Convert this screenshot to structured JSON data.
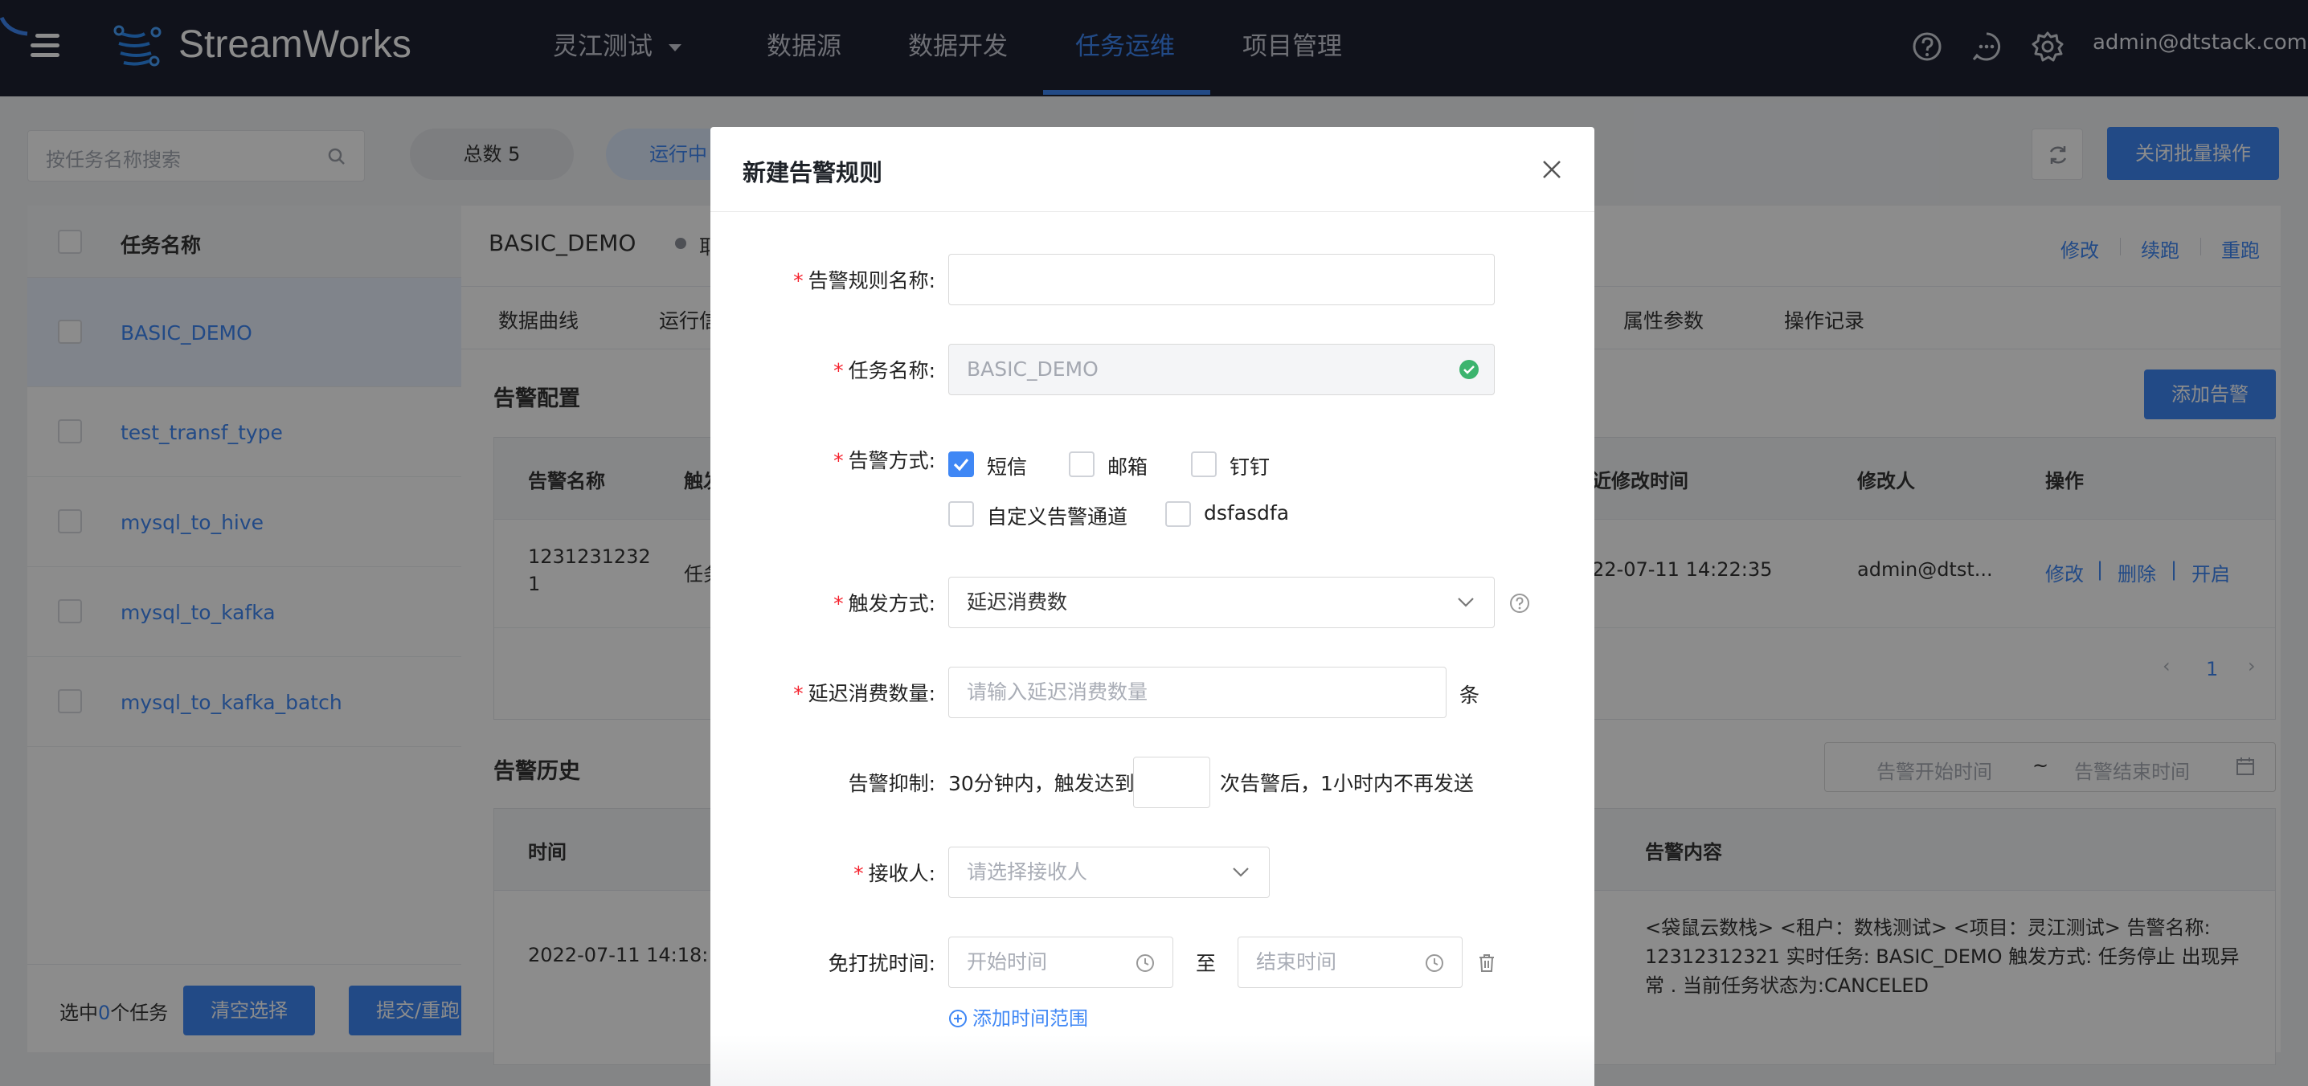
{
  "topbar": {
    "brand": "StreamWorks",
    "project": "灵江测试",
    "nav": [
      "数据源",
      "数据开发",
      "任务运维",
      "项目管理"
    ],
    "active_nav": "任务运维",
    "user": "admin@dtstack.com",
    "icons": [
      "menu-icon",
      "help-icon",
      "message-icon",
      "settings-icon"
    ]
  },
  "toolbar": {
    "search_placeholder": "按任务名称搜索",
    "total_label": "总数 5",
    "running_label": "运行中",
    "batch_close": "关闭批量操作"
  },
  "task_list": {
    "header": "任务名称",
    "items": [
      "BASIC_DEMO",
      "test_transf_type",
      "mysql_to_hive",
      "mysql_to_kafka",
      "mysql_to_kafka_batch"
    ],
    "selected_prefix": "选中",
    "selected_count": "0",
    "selected_suffix": "个任务",
    "clear_btn": "清空选择",
    "submit_btn": "提交/重跑"
  },
  "detail": {
    "task_name": "BASIC_DEMO",
    "status_partial": "耶",
    "actions": [
      "修改",
      "续跑",
      "重跑"
    ],
    "tabs": [
      "数据曲线",
      "运行信",
      "属性参数",
      "操作记录"
    ],
    "alarm_config_title": "告警配置",
    "add_alarm_btn": "添加告警",
    "config_table": {
      "headers": [
        "告警名称",
        "触发",
        "近修改时间",
        "修改人",
        "操作"
      ],
      "row": {
        "name_line1": "1231231232",
        "name_line2": "1",
        "trigger": "任务",
        "time": "22-07-11 14:22:35",
        "modifier": "admin@dtst...",
        "ops": [
          "修改",
          "删除",
          "开启"
        ]
      },
      "page": "1"
    },
    "history_title": "告警历史",
    "history_start_ph": "告警开始时间",
    "history_tilde": "~",
    "history_end_ph": "告警结束时间",
    "history_table": {
      "headers": [
        "时间",
        "告警内容"
      ],
      "row_time": "2022-07-11 14:18:",
      "content_lines": [
        "<袋鼠云数栈> <租户：数栈测试> <项目：灵江测试> 告警名称:",
        "12312312321 实时任务: BASIC_DEMO 触发方式: 任务停止 出现异",
        "常 . 当前任务状态为:CANCELED"
      ]
    }
  },
  "modal": {
    "title": "新建告警规则",
    "rule_name_label": "告警规则名称:",
    "rule_name_value": "",
    "task_name_label": "任务名称:",
    "task_name_value": "BASIC_DEMO",
    "method_label": "告警方式:",
    "methods": [
      {
        "label": "短信",
        "checked": true
      },
      {
        "label": "邮箱",
        "checked": false
      },
      {
        "label": "钉钉",
        "checked": false
      },
      {
        "label": "自定义告警通道",
        "checked": false
      },
      {
        "label": "dsfasdfa",
        "checked": false
      }
    ],
    "trigger_label": "触发方式:",
    "trigger_value": "延迟消费数",
    "delay_label": "延迟消费数量:",
    "delay_placeholder": "请输入延迟消费数量",
    "delay_unit": "条",
    "suppress_label": "告警抑制:",
    "suppress_prefix": "30分钟内，触发达到",
    "suppress_suffix": "次告警后，1小时内不再发送",
    "receiver_label": "接收人:",
    "receiver_placeholder": "请选择接收人",
    "dnd_label": "免打扰时间:",
    "dnd_start_ph": "开始时间",
    "dnd_to": "至",
    "dnd_end_ph": "结束时间",
    "add_range": "添加时间范围"
  }
}
